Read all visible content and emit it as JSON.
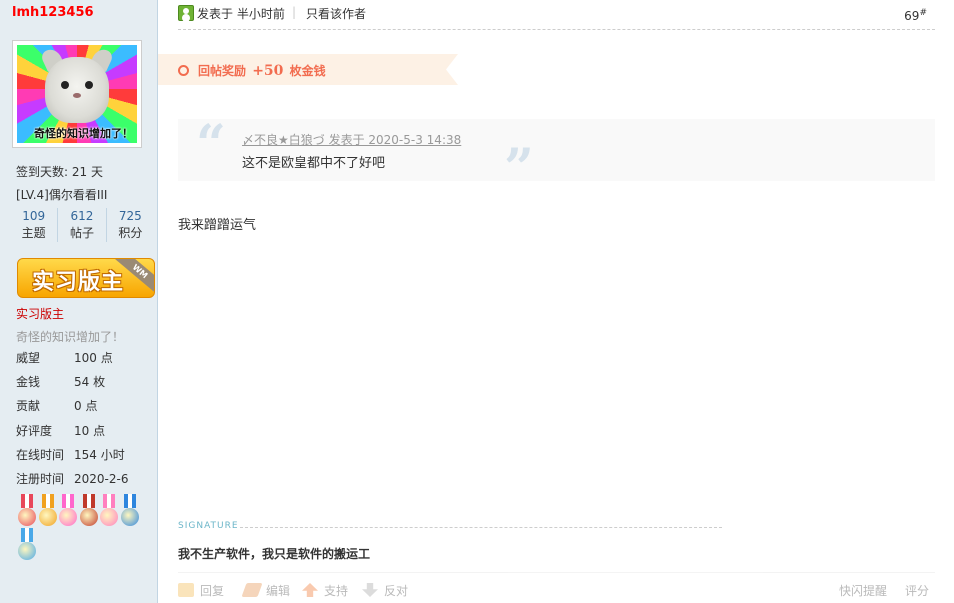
{
  "profile": {
    "username": "lmh123456",
    "avatar_caption": "奇怪的知识增加了！",
    "checkin": "签到天数: 21 天",
    "level": "[LV.4]偶尔看看III",
    "stats": [
      {
        "num": "109",
        "label": "主题"
      },
      {
        "num": "612",
        "label": "帖子"
      },
      {
        "num": "725",
        "label": "积分"
      }
    ],
    "badge_text": "实习版主",
    "badge_ribbon": "WM",
    "rank": "实习版主",
    "motto": "奇怪的知识增加了！",
    "fields": [
      {
        "key": "威望",
        "value": "100 点"
      },
      {
        "key": "金钱",
        "value": "54 枚"
      },
      {
        "key": "贡献",
        "value": "0 点"
      },
      {
        "key": "好评度",
        "value": "10 点"
      },
      {
        "key": "在线时间",
        "value": "154 小时"
      },
      {
        "key": "注册时间",
        "value": "2020-2-6"
      }
    ],
    "medal_colors": [
      "#e8475a",
      "#f0a11f",
      "#ff66cc",
      "#c0392b",
      "#ff7fbf",
      "#2e86de",
      "#49a8e8"
    ]
  },
  "post": {
    "posted": "发表于 半小时前",
    "separator": "|",
    "author_only": "只看该作者",
    "floor": "69",
    "floor_mark": "#",
    "reward_prefix": "回帖奖励",
    "reward_amount": "+50",
    "reward_suffix": "枚金钱",
    "quote_open": "“",
    "quote_close": "”",
    "quote_meta": "〆不良★白狼づ 发表于 2020-5-3 14:38",
    "quote_text": "这不是欧皇都中不了好吧",
    "reply_text": "我来蹭蹭运气",
    "signature_label": "SIGNATURE",
    "signature_text": "我不生产软件，我只是软件的搬运工"
  },
  "actions": {
    "reply": "回复",
    "edit": "编辑",
    "support": "支持",
    "oppose": "反对",
    "flash": "快闪提醒",
    "rate": "评分"
  },
  "colors": {
    "sidebar_bg": "#e5edf2",
    "username": "#ff0000",
    "reward": "#f26c4f",
    "stat_num": "#336699"
  }
}
